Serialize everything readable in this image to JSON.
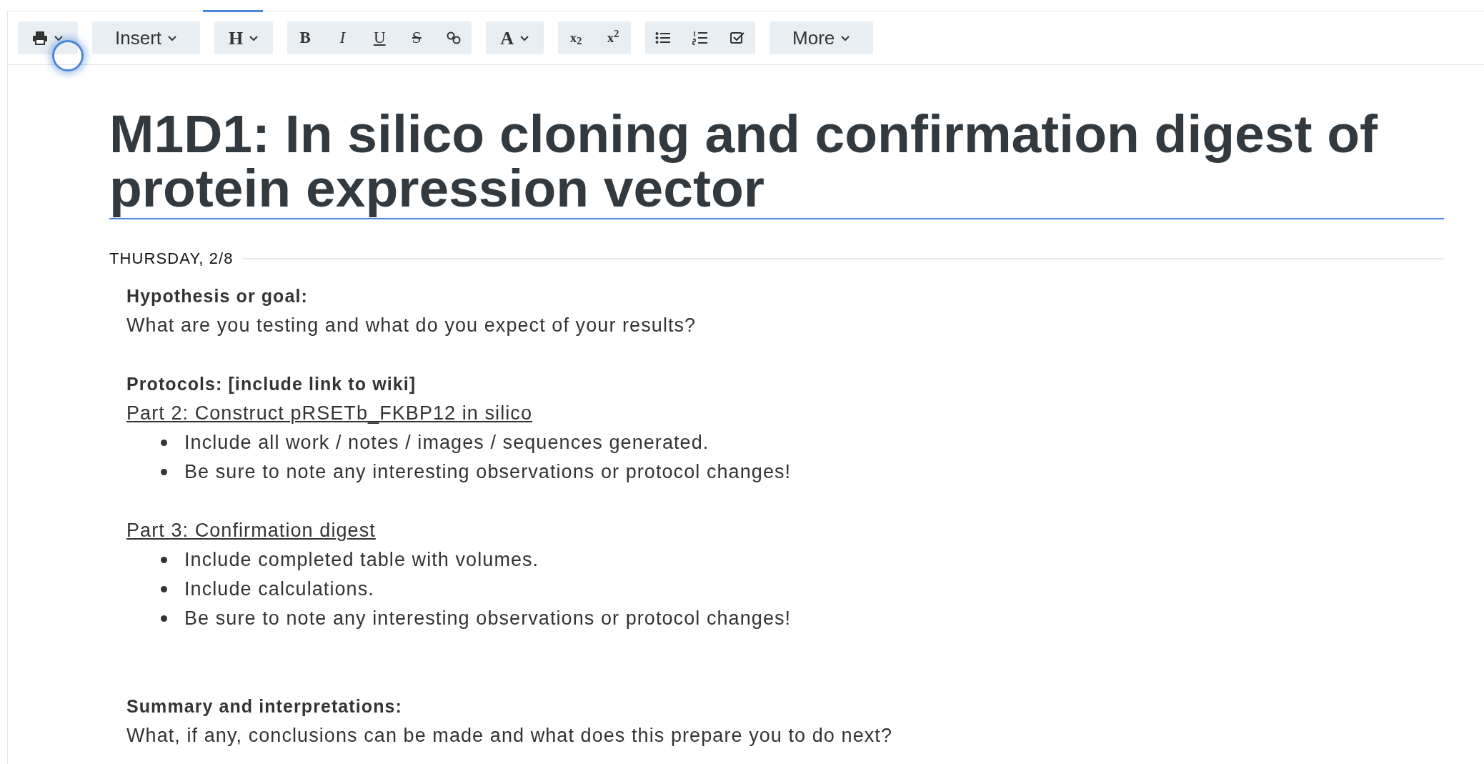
{
  "toolbar": {
    "groups": [
      [
        {
          "kind": "icon"
        }
      ],
      [
        {
          "kind": "text",
          "label": "Insert"
        }
      ],
      [
        {
          "kind": "text",
          "label": "H"
        }
      ],
      [
        {
          "kind": "text",
          "label": "B"
        },
        {
          "kind": "text",
          "label": "I"
        },
        {
          "kind": "text",
          "label": "U"
        },
        {
          "kind": "text",
          "label": "S"
        },
        {
          "kind": "icon"
        }
      ],
      [
        {
          "kind": "text",
          "label": "A"
        }
      ],
      [
        {
          "kind": "text",
          "label": "x$_{2}$"
        },
        {
          "kind": "text",
          "label": "x$^{2}$"
        }
      ],
      [
        {
          "kind": "icon"
        },
        {
          "kind": "icon"
        },
        {
          "kind": "icon"
        }
      ],
      [
        {
          "kind": "text",
          "label": "More"
        }
      ]
    ]
  },
  "document": {
    "title": "M1D1: In silico cloning and confirmation digest of protein expression vector",
    "date": "THURSDAY, 2/8",
    "blocks": [
      {
        "kind": "heading",
        "text": "Hypothesis or goal:"
      },
      {
        "kind": "paragraph",
        "text": "What are you testing and what do you expect of your results?"
      },
      {
        "kind": "gap"
      },
      {
        "kind": "heading",
        "text": "Protocols: [include link to wiki]"
      },
      {
        "kind": "link",
        "text": "Part 2: Construct pRSETb_FKBP12 in silico"
      },
      {
        "kind": "list",
        "items": [
          "Include all work / notes / images / sequences generated.",
          "Be sure to note any interesting observations or protocol changes!"
        ]
      },
      {
        "kind": "gap"
      },
      {
        "kind": "link",
        "text": "Part 3: Confirmation digest"
      },
      {
        "kind": "list",
        "items": [
          "Include completed table with volumes.",
          "Include calculations.",
          "Be sure to note any interesting observations or protocol changes!"
        ]
      },
      {
        "kind": "gap"
      },
      {
        "kind": "gap"
      },
      {
        "kind": "heading",
        "text": "Summary and interpretations:"
      },
      {
        "kind": "paragraph",
        "text": "What, if any, conclusions can be made and what does this prepare you to do next?"
      }
    ]
  }
}
